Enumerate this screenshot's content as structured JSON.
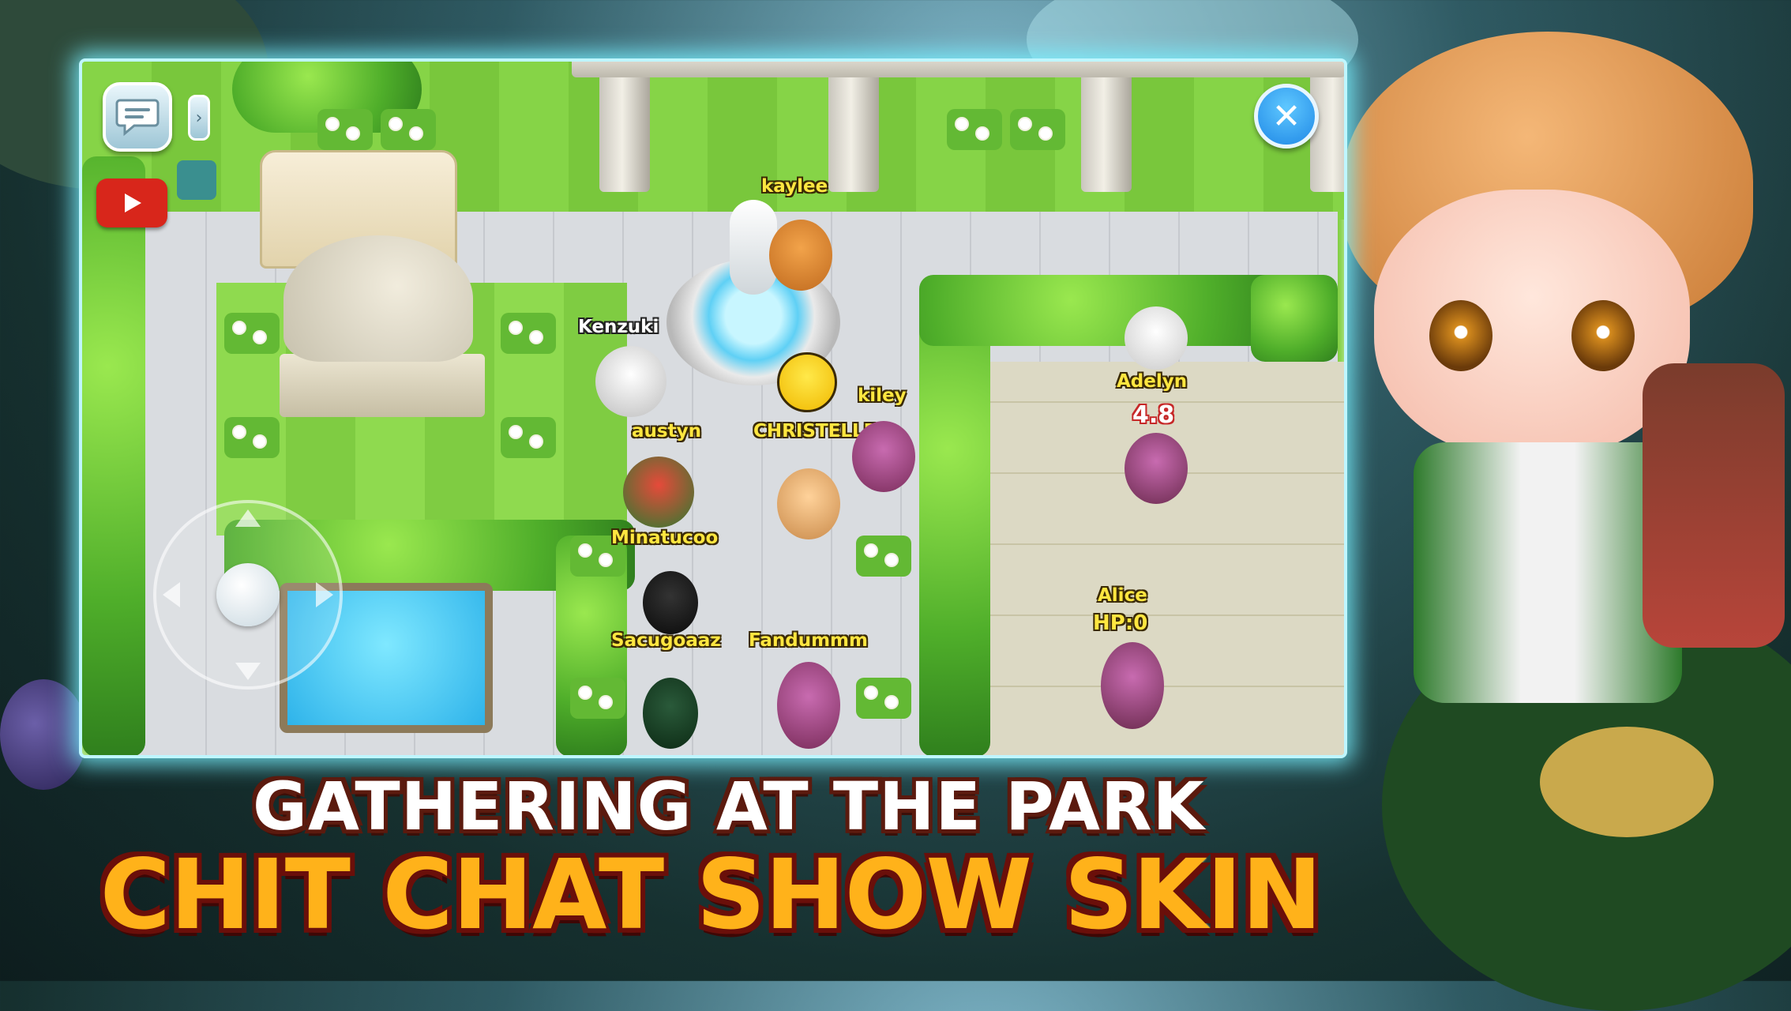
{
  "hud": {
    "chat_icon": "chat-bubble-icon",
    "expand_glyph": "›",
    "youtube_icon": "play-icon",
    "close_glyph": "✕"
  },
  "players": {
    "kaylee": "kaylee",
    "kenzuki": "Kenzuki",
    "kiley": "kiley",
    "austyn": "austyn",
    "christelle": "CHRISTELLE",
    "adelyn": "Adelyn",
    "adelyn_level": "4.8",
    "minatucoo": "Minatucoo",
    "sacugoaaz": "Sacugoaaz",
    "fandummm": "Fandummm",
    "alice": "Alice",
    "alice_hp": "HP:0"
  },
  "banner": {
    "line1": "GATHERING AT THE PARK",
    "line2": "CHIT CHAT SHOW SKIN"
  },
  "colors": {
    "accent_glow": "#78f0ff",
    "name_tag": "#ffe640",
    "banner_orange": "#ffb21a",
    "close_button_blue": "#1f88e6",
    "youtube_red": "#d8261b"
  }
}
